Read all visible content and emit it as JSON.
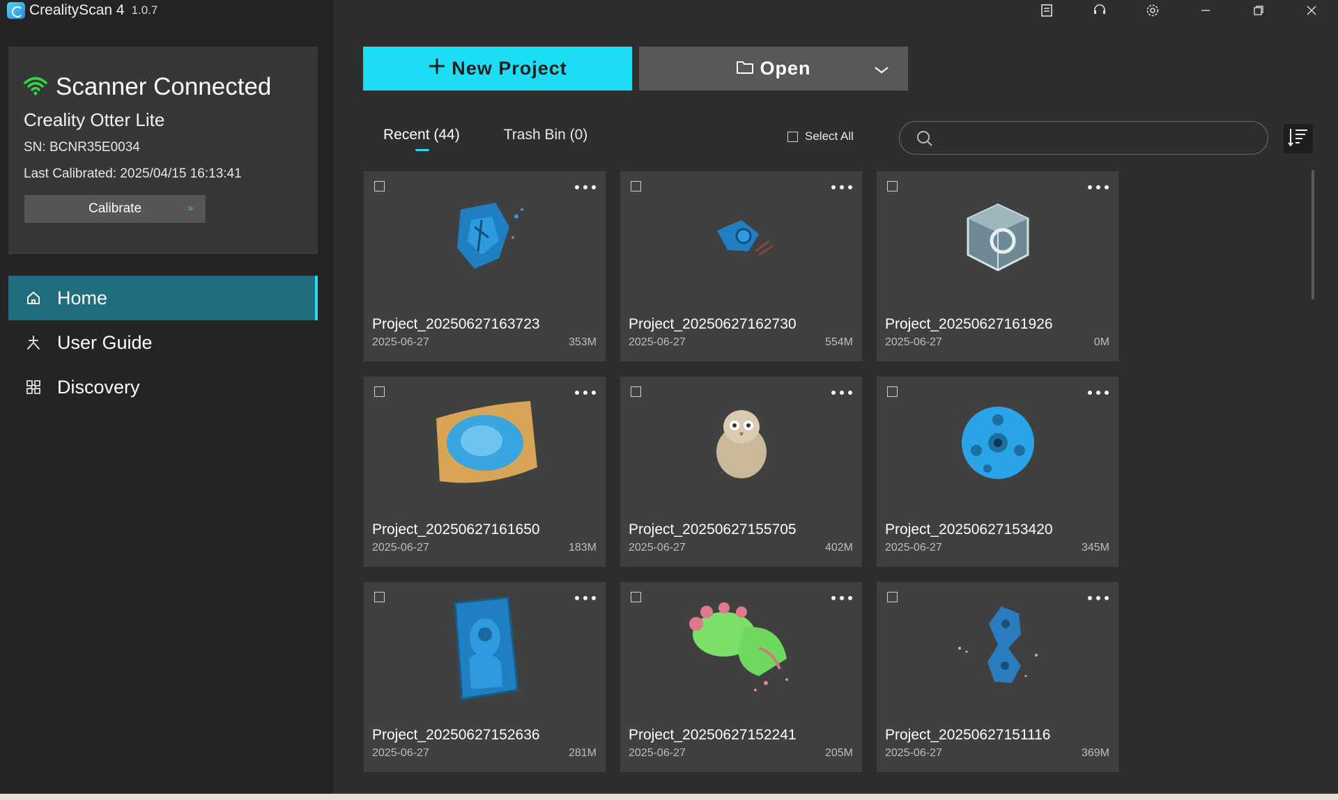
{
  "app": {
    "name": "CrealityScan 4",
    "version": "1.0.7"
  },
  "window": {
    "icons": [
      "notes-icon",
      "support-icon",
      "settings-icon",
      "minimize-icon",
      "restore-icon",
      "close-icon"
    ]
  },
  "scanner": {
    "status": "Scanner Connected",
    "device": "Creality Otter Lite",
    "sn": "SN: BCNR35E0034",
    "last_calibrated": "Last Calibrated: 2025/04/15 16:13:41",
    "calibrate_label": "Calibrate",
    "status_color": "#2fd94a"
  },
  "nav": {
    "items": [
      {
        "label": "Home",
        "icon": "home-icon",
        "active": true
      },
      {
        "label": "User Guide",
        "icon": "user-guide-icon"
      },
      {
        "label": "Discovery",
        "icon": "discovery-icon"
      }
    ]
  },
  "toolbar": {
    "new_project": "New Project",
    "open": "Open"
  },
  "tabs": {
    "recent": "Recent (44)",
    "trash": "Trash Bin (0)"
  },
  "select_all": "Select All",
  "search": {
    "placeholder": ""
  },
  "accent_color": "#1dddf5",
  "projects": [
    {
      "title": "Project_20250627163723",
      "date": "2025-06-27",
      "size": "353M",
      "thumb": "blue-mesh-scan"
    },
    {
      "title": "Project_20250627162730",
      "date": "2025-06-27",
      "size": "554M",
      "thumb": "blue-partial-scan"
    },
    {
      "title": "Project_20250627161926",
      "date": "2025-06-27",
      "size": "0M",
      "thumb": "empty-project-cube"
    },
    {
      "title": "Project_20250627161650",
      "date": "2025-06-27",
      "size": "183M",
      "thumb": "blue-gold-surface-scan"
    },
    {
      "title": "Project_20250627155705",
      "date": "2025-06-27",
      "size": "402M",
      "thumb": "owl-figurine-scan"
    },
    {
      "title": "Project_20250627153420",
      "date": "2025-06-27",
      "size": "345M",
      "thumb": "blue-disc-scan"
    },
    {
      "title": "Project_20250627152636",
      "date": "2025-06-27",
      "size": "281M",
      "thumb": "icon-relief-scan"
    },
    {
      "title": "Project_20250627152241",
      "date": "2025-06-27",
      "size": "205M",
      "thumb": "bust-statue-scan"
    },
    {
      "title": "Project_20250627151116",
      "date": "2025-06-27",
      "size": "369M",
      "thumb": "blue-sparse-scan"
    }
  ]
}
